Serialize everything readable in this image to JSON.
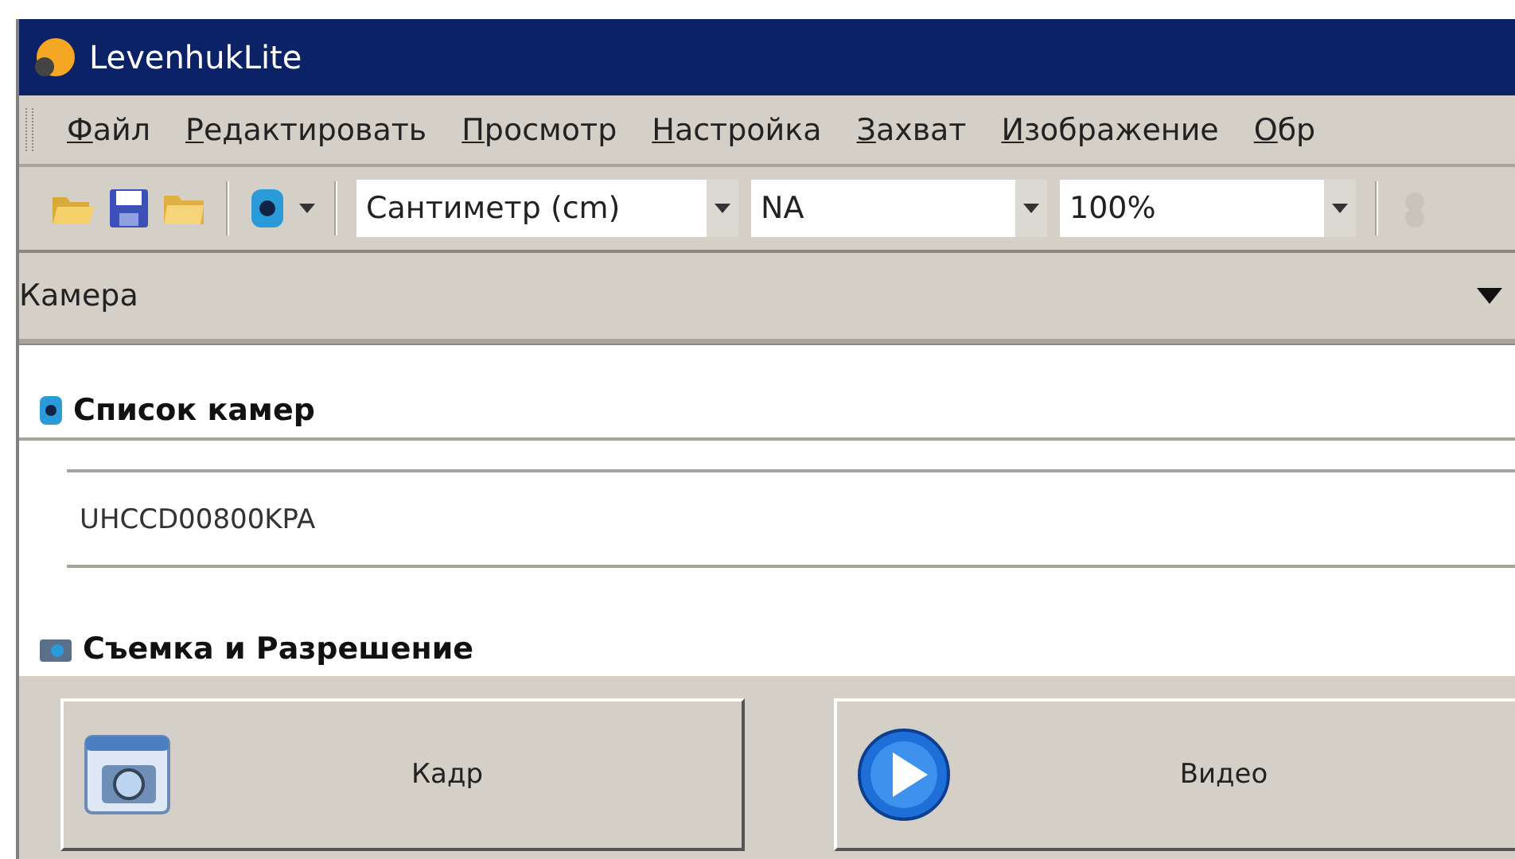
{
  "window": {
    "title": "LevenhukLite"
  },
  "menu": [
    "Файл",
    "Редактировать",
    "Просмотр",
    "Настройка",
    "Захват",
    "Изображение",
    "Обр"
  ],
  "toolbar": {
    "unit": "Сантиметр (cm)",
    "magnification": "NA",
    "zoom": "100%"
  },
  "panel": {
    "title": "Камера"
  },
  "camera_list": {
    "title": "Список камер",
    "items": [
      "UHCCD00800KPA"
    ]
  },
  "capture": {
    "title": "Съемка и Разрешение",
    "buttons": [
      {
        "label": "Кадр",
        "kind": "snapshot"
      },
      {
        "label": "Видео",
        "kind": "video"
      }
    ]
  }
}
